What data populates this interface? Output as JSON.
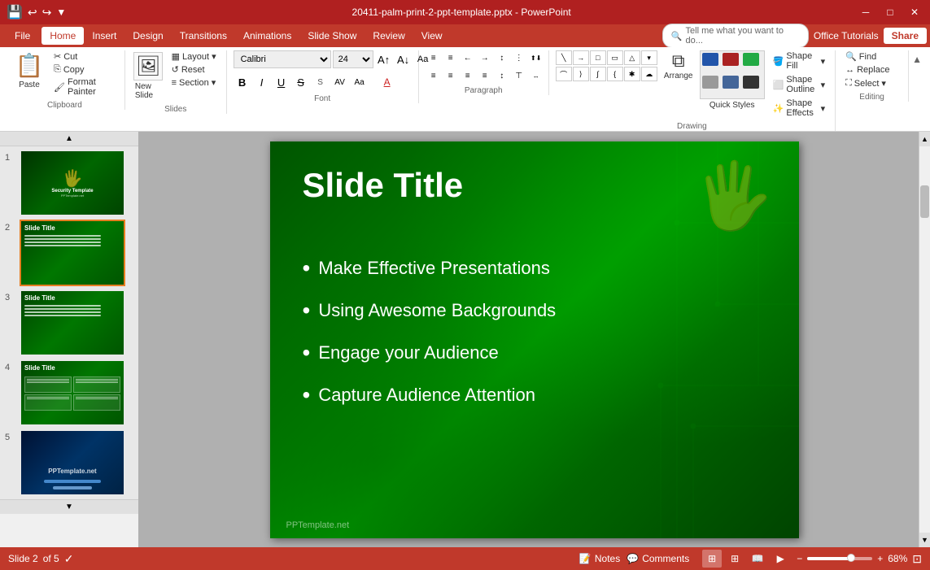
{
  "titleBar": {
    "fileName": "20411-palm-print-2-ppt-template.pptx - PowerPoint",
    "quickAccess": [
      "save",
      "undo",
      "redo",
      "customize"
    ],
    "windowControls": [
      "minimize",
      "restore",
      "close"
    ]
  },
  "menuBar": {
    "fileBtn": "File",
    "tabs": [
      "Home",
      "Insert",
      "Design",
      "Transitions",
      "Animations",
      "Slide Show",
      "Review",
      "View"
    ],
    "activeTab": "Home",
    "searchPlaceholder": "Tell me what you want to do...",
    "officeTutorials": "Office Tutorials",
    "share": "Share"
  },
  "ribbon": {
    "clipboard": {
      "label": "Clipboard",
      "paste": "Paste",
      "cut": "Cut",
      "copy": "Copy",
      "formatPainter": "Format Painter"
    },
    "slides": {
      "label": "Slides",
      "newSlide": "New Slide",
      "layout": "Layout",
      "reset": "Reset",
      "section": "Section"
    },
    "font": {
      "label": "Font",
      "fontName": "Calibri",
      "fontSize": "24",
      "bold": "B",
      "italic": "I",
      "underline": "U",
      "strikethrough": "S",
      "shadow": "S",
      "fontColor": "A"
    },
    "paragraph": {
      "label": "Paragraph",
      "bulletList": "≡",
      "numberedList": "≡",
      "decreaseIndent": "←",
      "increaseIndent": "→",
      "alignLeft": "≡",
      "alignCenter": "≡",
      "alignRight": "≡",
      "justify": "≡",
      "columns": "≡",
      "lineSpacing": "≡"
    },
    "drawing": {
      "label": "Drawing",
      "quickStyles": "Quick Styles",
      "shapeFill": "Shape Fill",
      "shapeOutline": "Shape Outline",
      "shapeEffects": "Shape Effects",
      "arrange": "Arrange"
    },
    "editing": {
      "label": "Editing",
      "find": "Find",
      "replace": "Replace",
      "select": "Select"
    }
  },
  "slides": [
    {
      "num": "1",
      "type": "title-slide",
      "title": "Security Template"
    },
    {
      "num": "2",
      "type": "content-slide",
      "title": "Slide Title",
      "selected": true
    },
    {
      "num": "3",
      "type": "content-slide",
      "title": "Slide Title"
    },
    {
      "num": "4",
      "type": "table-slide",
      "title": "Slide Title"
    },
    {
      "num": "5",
      "type": "blue-slide",
      "title": "PPTemplate.net"
    }
  ],
  "mainSlide": {
    "title": "Slide Title",
    "bullets": [
      "Make Effective Presentations",
      "Using Awesome Backgrounds",
      "Engage your Audience",
      "Capture Audience Attention"
    ],
    "watermark": "PPTemplate.net"
  },
  "statusBar": {
    "slideInfo": "Slide 2",
    "of": "of 5",
    "notes": "Notes",
    "comments": "Comments",
    "zoom": "68%"
  }
}
